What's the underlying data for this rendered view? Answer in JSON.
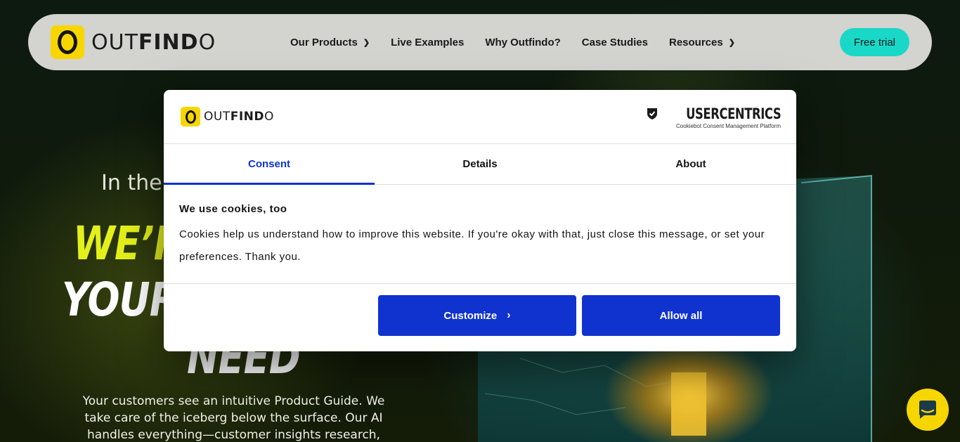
{
  "nav": {
    "logo_light": "OUT",
    "logo_bold": "FIND",
    "logo_end": "O",
    "links": [
      {
        "label": "Our Products",
        "dropdown": true
      },
      {
        "label": "Live Examples",
        "dropdown": false
      },
      {
        "label": "Why Outfindo?",
        "dropdown": false
      },
      {
        "label": "Case Studies",
        "dropdown": false
      },
      {
        "label": "Resources",
        "dropdown": true
      }
    ],
    "cta": "Free trial"
  },
  "hero": {
    "kicker": "In the",
    "line1": "WE’R",
    "line2": "YOUR",
    "line3": "NEED",
    "description": "Your customers see an intuitive Product Guide. We take care of the iceberg below the surface. Our AI handles everything—customer insights research, conversation"
  },
  "dialog": {
    "brand": "USERCENTRICS",
    "brand_sub": "Cookiebot Consent Management Platform",
    "tabs": [
      {
        "label": "Consent",
        "active": true
      },
      {
        "label": "Details",
        "active": false
      },
      {
        "label": "About",
        "active": false
      }
    ],
    "title": "We use cookies, too",
    "text": "Cookies help us understand how to improve this website. If you're okay with that, just close this message, or set your preferences. Thank you.",
    "customize_label": "Customize",
    "allow_label": "Allow all"
  },
  "colors": {
    "accent_blue": "#1032cf",
    "brand_yellow": "#f7d600",
    "cta_teal": "#19d8c8",
    "hero_yellow": "#e4f01a"
  },
  "icons": {
    "chevron": "chevron-down-icon",
    "arrow": "chevron-right-icon",
    "chat": "chat-bubble-icon"
  }
}
